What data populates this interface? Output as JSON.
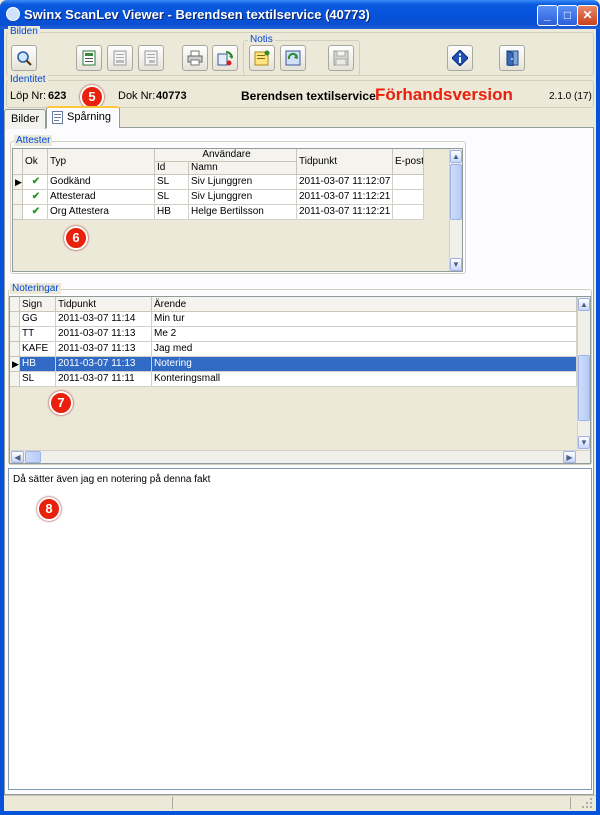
{
  "window": {
    "title": "Swinx ScanLev Viewer - Berendsen textilservice (40773)",
    "minimize": "_",
    "maximize": "□",
    "close": "✕"
  },
  "groups": {
    "bilden": "Bilden",
    "notis": "Notis",
    "identitet": "Identitet",
    "attester": "Attester",
    "noteringar": "Noteringar"
  },
  "toolbar": {
    "icons": [
      "magnify-icon",
      "document-view-icon",
      "document-gray-icon",
      "document-gray-2-icon",
      "print-icon",
      "rotate-icon",
      "note-add-icon",
      "note-refresh-icon",
      "save-disk-icon",
      "info-icon",
      "exit-door-icon"
    ]
  },
  "identity": {
    "lop_label": "Löp Nr:",
    "lop_value": "623",
    "dok_label": "Dok Nr:",
    "dok_value": "40773",
    "company": "Berendsen textilservice",
    "preview": "Förhandsversion",
    "version": "2.1.0 (17)"
  },
  "badges": {
    "b5": "5",
    "b6": "6",
    "b7": "7",
    "b8": "8"
  },
  "tabs": {
    "bilder": "Bilder",
    "sparning": "Spårning"
  },
  "attester": {
    "headers": {
      "ok": "Ok",
      "typ": "Typ",
      "anvandare": "Användare",
      "id": "Id",
      "namn": "Namn",
      "tidpunkt": "Tidpunkt",
      "epost": "E-post"
    },
    "rows": [
      {
        "ok": "✔",
        "typ": "Godkänd",
        "id": "SL",
        "namn": "Siv  Ljunggren",
        "tidpunkt": "2011-03-07 11:12:07",
        "epost": ""
      },
      {
        "ok": "✔",
        "typ": "Attesterad",
        "id": "SL",
        "namn": "Siv  Ljunggren",
        "tidpunkt": "2011-03-07 11:12:21",
        "epost": ""
      },
      {
        "ok": "✔",
        "typ": "Org Attestera",
        "id": "HB",
        "namn": "Helge  Bertilsson",
        "tidpunkt": "2011-03-07 11:12:21",
        "epost": ""
      }
    ]
  },
  "noteringar": {
    "headers": {
      "sign": "Sign",
      "tidpunkt": "Tidpunkt",
      "arende": "Ärende"
    },
    "rows": [
      {
        "sign": "GG",
        "tidpunkt": "2011-03-07 11:14",
        "arende": "Min tur"
      },
      {
        "sign": "TT",
        "tidpunkt": "2011-03-07 11:13",
        "arende": "Me 2"
      },
      {
        "sign": "KAFE",
        "tidpunkt": "2011-03-07 11:13",
        "arende": "Jag med"
      },
      {
        "sign": "HB",
        "tidpunkt": "2011-03-07 11:13",
        "arende": "Notering"
      },
      {
        "sign": "SL",
        "tidpunkt": "2011-03-07 11:11",
        "arende": "Konteringsmall"
      }
    ]
  },
  "note_text": "Då sätter även jag en notering på denna fakt",
  "colors": {
    "accent": "#0553db",
    "selected_row": "#316ac5",
    "preview_text": "#e8200c",
    "badge": "#e8200c"
  }
}
